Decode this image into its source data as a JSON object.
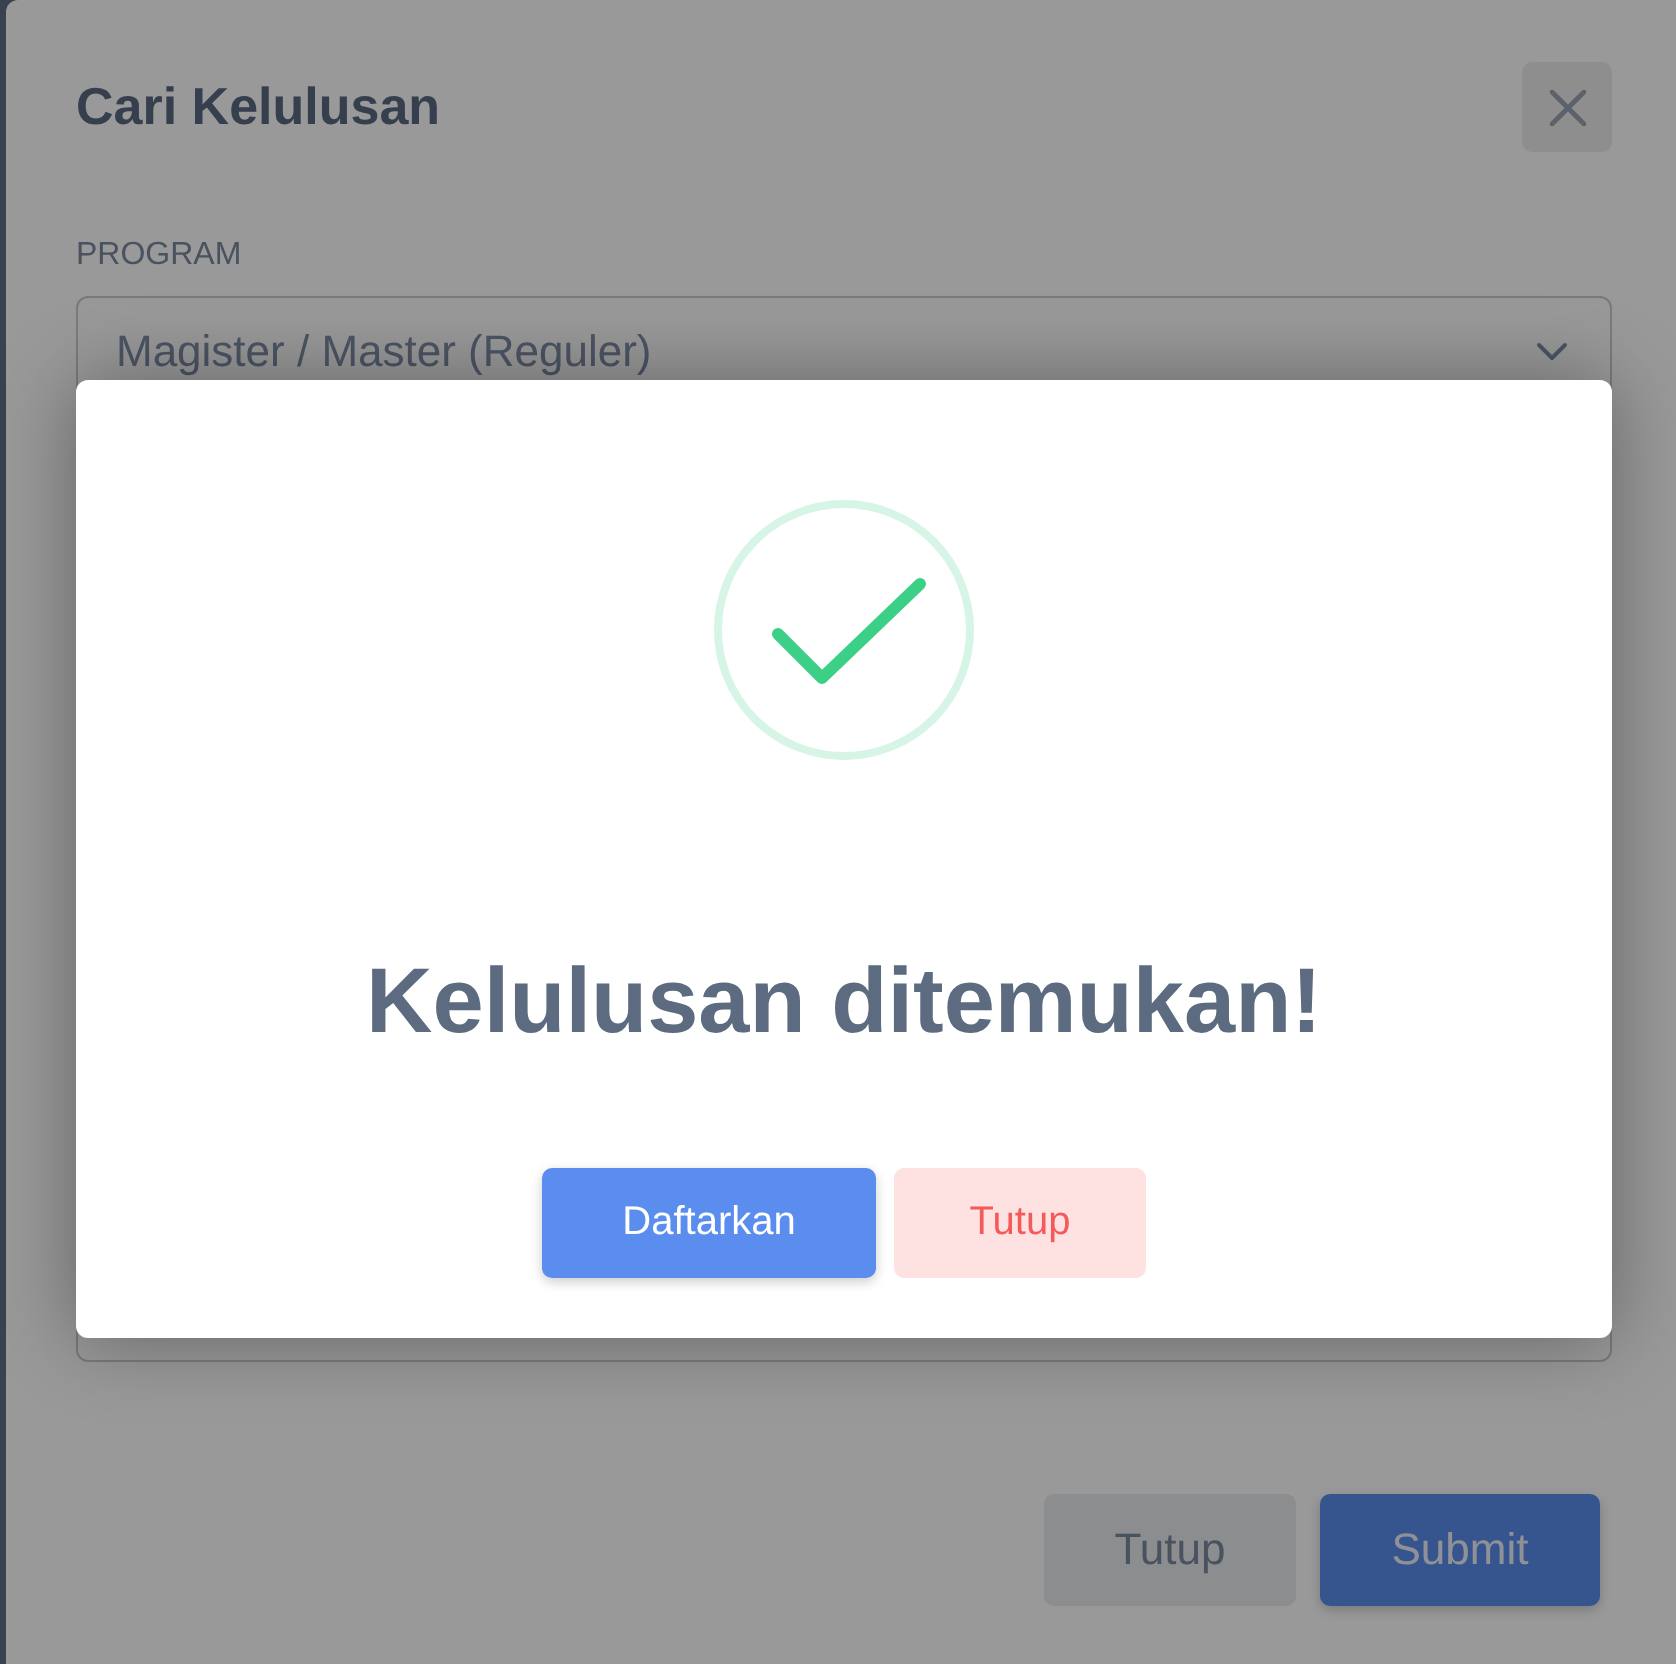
{
  "dialog": {
    "title": "Cari Kelulusan",
    "fields": [
      {
        "label": "PROGRAM",
        "value": "Magister / Master (Reguler)"
      }
    ],
    "buttons": [
      {
        "label": "Tutup",
        "kind": "secondary"
      },
      {
        "label": "Submit",
        "kind": "primary"
      }
    ]
  },
  "alert": {
    "kind": "success",
    "title": "Kelulusan ditemukan!",
    "buttons": [
      {
        "label": "Daftarkan",
        "kind": "confirm"
      },
      {
        "label": "Tutup",
        "kind": "cancel"
      }
    ]
  }
}
